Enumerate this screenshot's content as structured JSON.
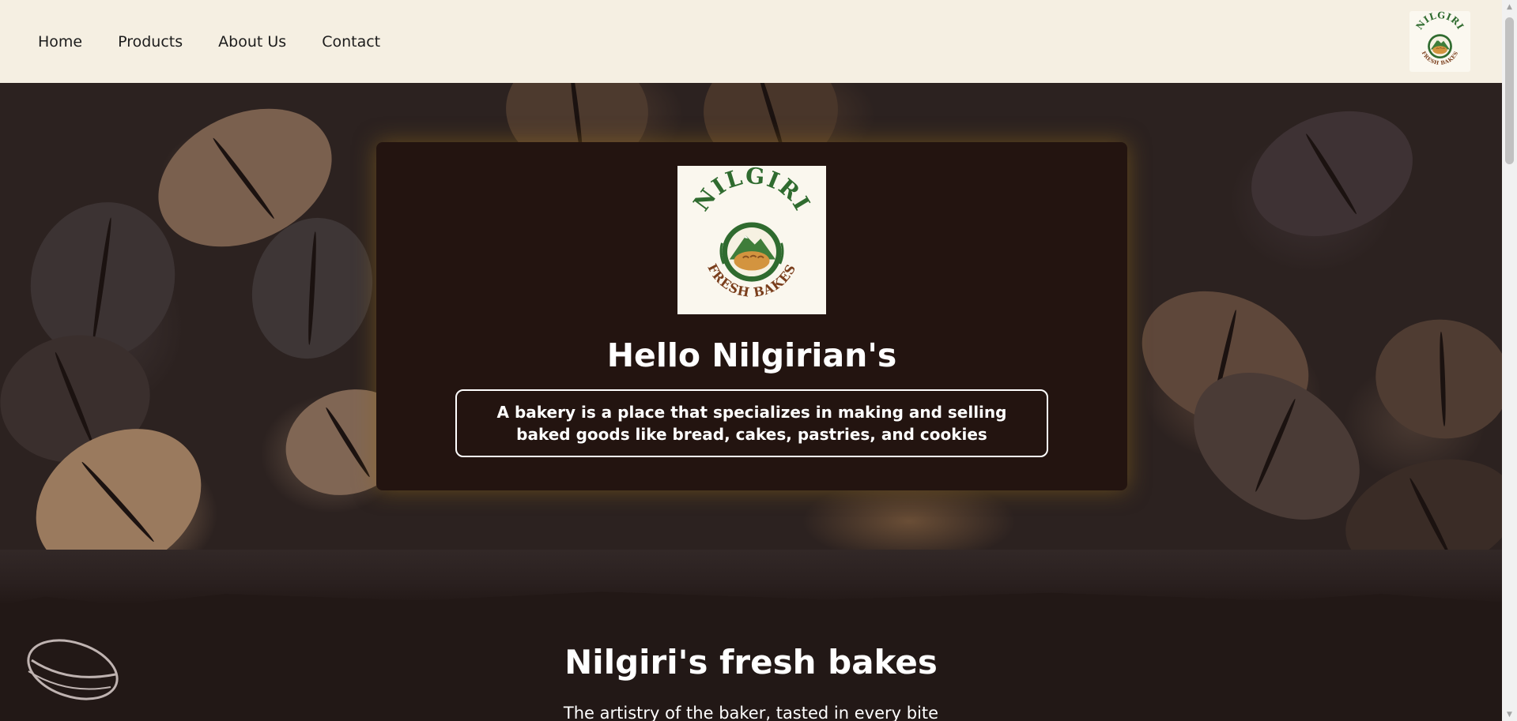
{
  "nav": {
    "items": [
      {
        "label": "Home"
      },
      {
        "label": "Products"
      },
      {
        "label": "About Us"
      },
      {
        "label": "Contact"
      }
    ]
  },
  "logo": {
    "top_text": "NILGIRI",
    "bottom_text": "FRESH BAKES",
    "colors": {
      "green": "#2f6b2f",
      "brown": "#7a3e1c",
      "bread": "#d3943f",
      "cream": "#faf7ee"
    }
  },
  "hero": {
    "title": "Hello Nilgirian's",
    "description": "A bakery is a place that specializes in making and selling baked goods like bread, cakes, pastries, and cookies"
  },
  "about": {
    "title": "Nilgiri's fresh bakes",
    "tagline": "The artistry of the baker, tasted in every bite"
  },
  "theme": {
    "header_bg": "#f5efe2",
    "card_bg": "#231410",
    "section_bg": "#221816",
    "card_glow": "#966e1e"
  }
}
